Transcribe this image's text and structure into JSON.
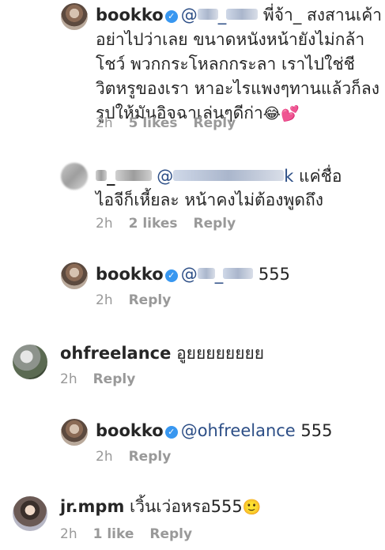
{
  "comments": [
    {
      "username": "bookko",
      "mention_prefix": "@",
      "mention_suffix": "_",
      "lines": [
        "พี่จ้า_ สงสานเค้า",
        "อย่าไปว่าเลย ขนาดหนังหน้ายังไม่กล้า",
        "โชว์ พวกกระโหลกกระลา เราไปใช่ชี",
        "วิตหรูของเรา หาอะไรแพงๆทานแล้วก็ลง",
        "รูปให้มันอิจฉาเล่นๆดีก่า"
      ],
      "emojis": "😂💕",
      "time": "2h",
      "likes": "5 likes",
      "reply": "Reply"
    },
    {
      "username_blurred": "_",
      "mention_prefix": "@",
      "mention_tail": "k",
      "line1_end": "แค่ชื่อ",
      "line2": "ไอจีก็เหี้ยละ หน้าคงไม่ต้องพูดถึง",
      "time": "2h",
      "likes": "2 likes",
      "reply": "Reply"
    },
    {
      "username": "bookko",
      "mention_prefix": "@",
      "mention_suffix": "_",
      "text": "555",
      "time": "2h",
      "reply": "Reply"
    },
    {
      "username": "ohfreelance",
      "text": "อูยยยยยยยย",
      "time": "2h",
      "reply": "Reply"
    },
    {
      "username": "bookko",
      "mention": "@ohfreelance",
      "text": "555",
      "time": "2h",
      "reply": "Reply"
    },
    {
      "username": "jr.mpm",
      "text": "เวิ้นเว่อหรอ555",
      "emoji": "🙂",
      "time": "2h",
      "likes": "1 like",
      "reply": "Reply"
    }
  ],
  "verified_glyph": "✓",
  "icons": {
    "verified": "verified-badge-icon"
  },
  "colors": {
    "mention": "#2c4e86",
    "meta": "#999999",
    "verified": "#3897f0"
  }
}
